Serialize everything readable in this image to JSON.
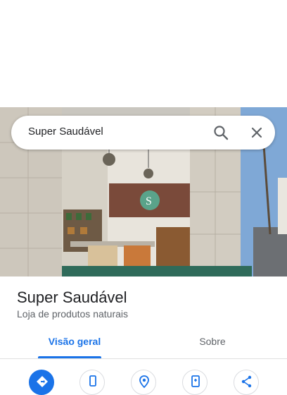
{
  "search": {
    "query": "Super Saudável"
  },
  "place": {
    "name": "Super Saudável",
    "category": "Loja de produtos naturais"
  },
  "tabs": [
    {
      "label": "Visão geral",
      "selected": true
    },
    {
      "label": "Sobre",
      "selected": false
    }
  ],
  "actions": [
    {
      "icon": "directions-icon"
    },
    {
      "icon": "phone-icon"
    },
    {
      "icon": "location-icon"
    },
    {
      "icon": "save-icon"
    },
    {
      "icon": "share-icon"
    }
  ],
  "colors": {
    "accent": "#1a73e8",
    "text": "#202124",
    "secondary_text": "#5f6368"
  }
}
